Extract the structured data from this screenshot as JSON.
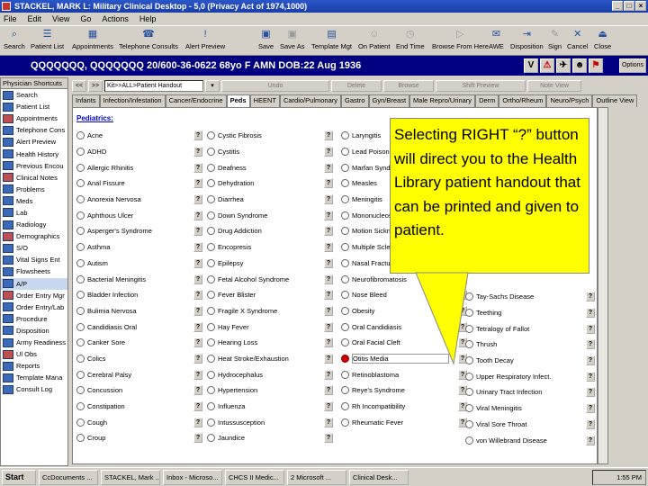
{
  "window": {
    "title": "STACKEL, MARK L: Military Clinical Desktop - 5,0 (Privacy Act of 1974,1000)"
  },
  "menu": [
    "File",
    "Edit",
    "View",
    "Go",
    "Actions",
    "Help"
  ],
  "toolbar": [
    "Search",
    "Patient List",
    "Appointments",
    "Telephone Consults",
    "Alert Preview",
    "Save",
    "Save As",
    "Template Mgt",
    "On Patient",
    "End Time",
    "Browse From Here",
    "AWE",
    "Disposition",
    "Sign",
    "Cancel",
    "Close"
  ],
  "patient": {
    "banner": "QQQQQQQ, QQQQQQQ  20/600-36-0622  68yo  F  AMN  DOB:22 Aug 1936",
    "options_label": "Options"
  },
  "sidebar": {
    "header": "Physician Shortcuts",
    "items": [
      "Search",
      "Patient List",
      "Appointments",
      "Telephone Cons",
      "Alert Preview",
      "Health History",
      "Previous Encou",
      "Clinical Notes",
      "Problems",
      "Meds",
      "Lab",
      "Radiology",
      "Demographics",
      "S/O",
      "Vital Signs Ent",
      "Flowsheets",
      "A/P",
      "Order Entry Mgr",
      "Order Entry/Lab",
      "Procedure",
      "Disposition",
      "Army Readiness",
      "Ul Obs",
      "Reports",
      "Template Mana",
      "Consult Log"
    ]
  },
  "toolbar2": {
    "nav_back": "<<",
    "nav_fwd": ">>",
    "combo": "Kit>>ALL>Patient Handout",
    "buttons": [
      "Undo",
      "Delete",
      "Browse",
      "Shift Preview",
      "Note View"
    ]
  },
  "tabs": [
    "Infants",
    "Infection/Infestation",
    "Cancer/Endocrine",
    "Peds",
    "HEENT",
    "Cardio/Pulmonary",
    "Gastro",
    "Gyn/Breast",
    "Male Repro/Urinary",
    "Derm",
    "Ortho/Rheum",
    "Neuro/Psych",
    "Outline View"
  ],
  "section_title": "Pediatrics:",
  "columns": [
    [
      "Acne",
      "ADHD",
      "Allergic Rhinitis",
      "Anal Fissure",
      "Anorexia Nervosa",
      "Aphthous Ulcer",
      "Asperger's Syndrome",
      "Asthma",
      "Autism",
      "Bacterial Meningitis",
      "Bladder Infection",
      "Bulimia Nervosa",
      "Candidiasis Oral",
      "Canker Sore",
      "Colics",
      "Cerebral Palsy",
      "Concussion",
      "Constipation",
      "Cough",
      "Croup"
    ],
    [
      "Cystic Fibrosis",
      "Cystitis",
      "Deafness",
      "Dehydration",
      "Diarrhea",
      "Down Syndrome",
      "Drug Addiction",
      "Encopresis",
      "Epilepsy",
      "Fetal Alcohol Syndrome",
      "Fever Blister",
      "Fragile X Syndrome",
      "Hay Fever",
      "Hearing Loss",
      "Heat Stroke/Exhaustion",
      "Hydrocephalus",
      "Hypertension",
      "Influenza",
      "Intussusception",
      "Jaundice"
    ],
    [
      "Laryngitis",
      "Lead Poisoning",
      "Marfan Syndrome",
      "Measles",
      "Meningitis",
      "Mononucleosis",
      "Motion Sickness",
      "Multiple Sclerosis",
      "Nasal Fracture",
      "Neurofibromatosis",
      "Nose Bleed",
      "Obesity",
      "Oral Candidiasis",
      "Oral Facial Cleft",
      "Otitis Media",
      "Retinoblastoma",
      "Reye's Syndrome",
      "Rh Incompatibility",
      "Rheumatic Fever"
    ],
    [
      "Tay-Sachs Disease",
      "Teething",
      "Tetralogy of Fallot",
      "Thrush",
      "Tooth Decay",
      "Upper Respiratory Infect.",
      "Urinary Tract Infection",
      "Viral Meningitis",
      "Viral Sore Throat",
      "von Willebrand Disease"
    ]
  ],
  "help_button_label": "?",
  "callout": {
    "text": "Selecting RIGHT “?” button will direct you to the Health Library patient handout that can be printed and given to patient."
  },
  "taskbar": {
    "start": "Start",
    "tasks": [
      "CcDocuments ...",
      "STACKEL, Mark ...",
      "Inbox - Microso...",
      "CHCS II Medic...",
      "2 Microsoft ...",
      "Clinical Desk..."
    ],
    "clock": "1:55 PM"
  }
}
